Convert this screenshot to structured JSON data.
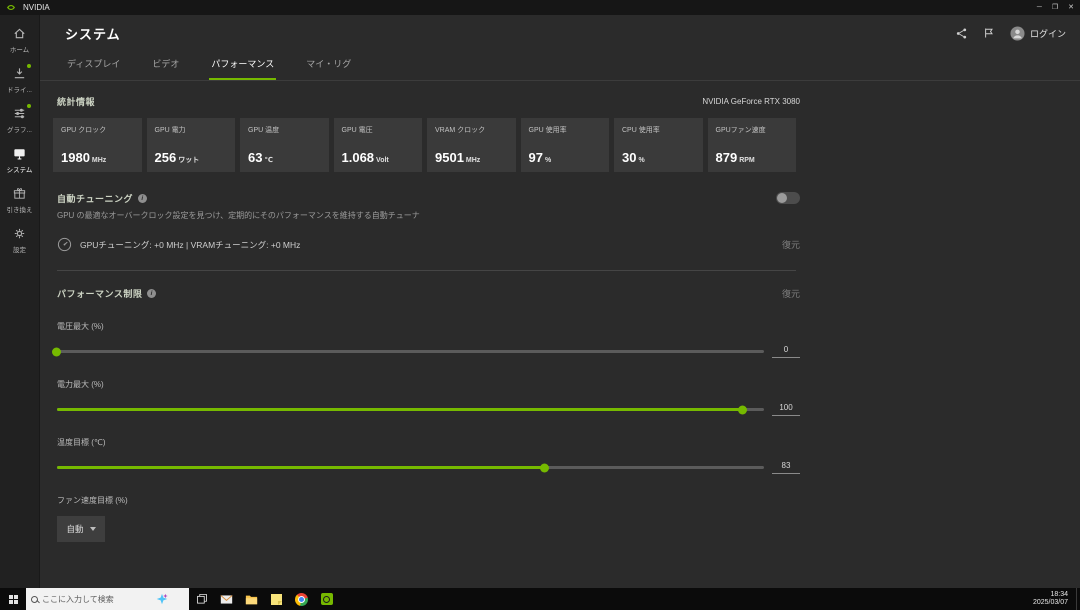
{
  "colors": {
    "accent": "#76b900"
  },
  "titlebar": {
    "app_name": "NVIDIA",
    "minimize_glyph": "─",
    "maximize_glyph": "❐",
    "close_glyph": "✕"
  },
  "sidebar": {
    "items": [
      {
        "label": "ホーム",
        "icon": "home-icon",
        "active": false,
        "badge": false
      },
      {
        "label": "ドライ...",
        "icon": "drivers-icon",
        "active": false,
        "badge": true
      },
      {
        "label": "グラフ...",
        "icon": "graphics-icon",
        "active": false,
        "badge": true
      },
      {
        "label": "システム",
        "icon": "system-icon",
        "active": true,
        "badge": false
      },
      {
        "label": "引き換え",
        "icon": "redeem-icon",
        "active": false,
        "badge": false
      },
      {
        "label": "設定",
        "icon": "settings-icon",
        "active": false,
        "badge": false
      }
    ]
  },
  "header": {
    "title": "システム",
    "icons": [
      "share-icon",
      "feedback-icon",
      "avatar"
    ],
    "login_label": "ログイン"
  },
  "tabs": [
    {
      "label": "ディスプレイ",
      "active": false
    },
    {
      "label": "ビデオ",
      "active": false
    },
    {
      "label": "パフォーマンス",
      "active": true
    },
    {
      "label": "マイ・リグ",
      "active": false
    }
  ],
  "stats": {
    "section_title": "統計情報",
    "gpu_name": "NVIDIA GeForce RTX 3080",
    "cards": [
      {
        "label": "GPU クロック",
        "value": "1980",
        "unit": "MHz"
      },
      {
        "label": "GPU 電力",
        "value": "256",
        "unit": "ワット"
      },
      {
        "label": "GPU 温度",
        "value": "63",
        "unit": "℃"
      },
      {
        "label": "GPU 電圧",
        "value": "1.068",
        "unit": "Volt"
      },
      {
        "label": "VRAM クロック",
        "value": "9501",
        "unit": "MHz"
      },
      {
        "label": "GPU 使用率",
        "value": "97",
        "unit": "%"
      },
      {
        "label": "CPU 使用率",
        "value": "30",
        "unit": "%"
      },
      {
        "label": "GPUファン速度",
        "value": "879",
        "unit": "RPM"
      }
    ]
  },
  "auto_tuning": {
    "title": "自動チューニング",
    "description": "GPU の最適なオーバークロック設定を見つけ、定期的にそのパフォーマンスを維持する自動チューナ",
    "enabled": false,
    "status_text": "GPUチューニング: +0 MHz | VRAMチューニング: +0 MHz",
    "restore_label": "復元"
  },
  "performance_limits": {
    "title": "パフォーマンス制限",
    "restore_label": "復元",
    "sliders": [
      {
        "label": "電圧最大 (%)",
        "value": "0",
        "position_pct": 0
      },
      {
        "label": "電力最大 (%)",
        "value": "100",
        "position_pct": 97
      },
      {
        "label": "温度目標 (℃)",
        "value": "83",
        "position_pct": 69
      }
    ],
    "fan_target": {
      "label": "ファン速度目標 (%)",
      "value": "自動"
    }
  },
  "taskbar": {
    "search_placeholder": "ここに入力して検索",
    "icons": [
      "start-icon",
      "search-icon",
      "copilot-sparkle-icon",
      "task-view-icon",
      "mail-icon",
      "file-explorer-icon",
      "sticky-notes-icon",
      "chrome-icon",
      "nvidia-app-icon"
    ],
    "clock": {
      "time": "18:34",
      "date": "2025/03/07"
    }
  }
}
